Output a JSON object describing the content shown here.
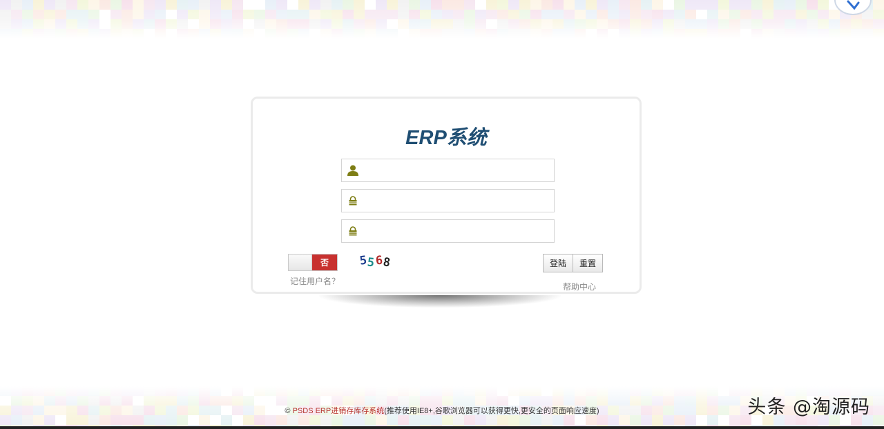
{
  "login": {
    "title": "ERP系统",
    "username": {
      "value": "",
      "placeholder": ""
    },
    "password": {
      "value": "",
      "placeholder": ""
    },
    "captcha_input": {
      "value": "",
      "placeholder": ""
    },
    "remember_toggle_state": "否",
    "remember_label": "记住用户名？",
    "captcha_text": "5568",
    "login_button": "登陆",
    "reset_button": "重置",
    "help_link": "帮助中心"
  },
  "footer": {
    "copyright_symbol": "©",
    "brand": "PSDS ERP进销存库存系统",
    "note": "(推荐使用IE8+,谷歌浏览器可以获得更快,更安全的页面响应速度)"
  },
  "watermark": "头条 @淘源码",
  "colors": {
    "title": "#1f4e73",
    "toggle_off": "#c8312f",
    "icon": "#7d7d14",
    "brand_text": "#b5302b"
  },
  "icons": [
    "user-icon",
    "lock-icon",
    "lock-icon",
    "corner-logo-icon"
  ]
}
